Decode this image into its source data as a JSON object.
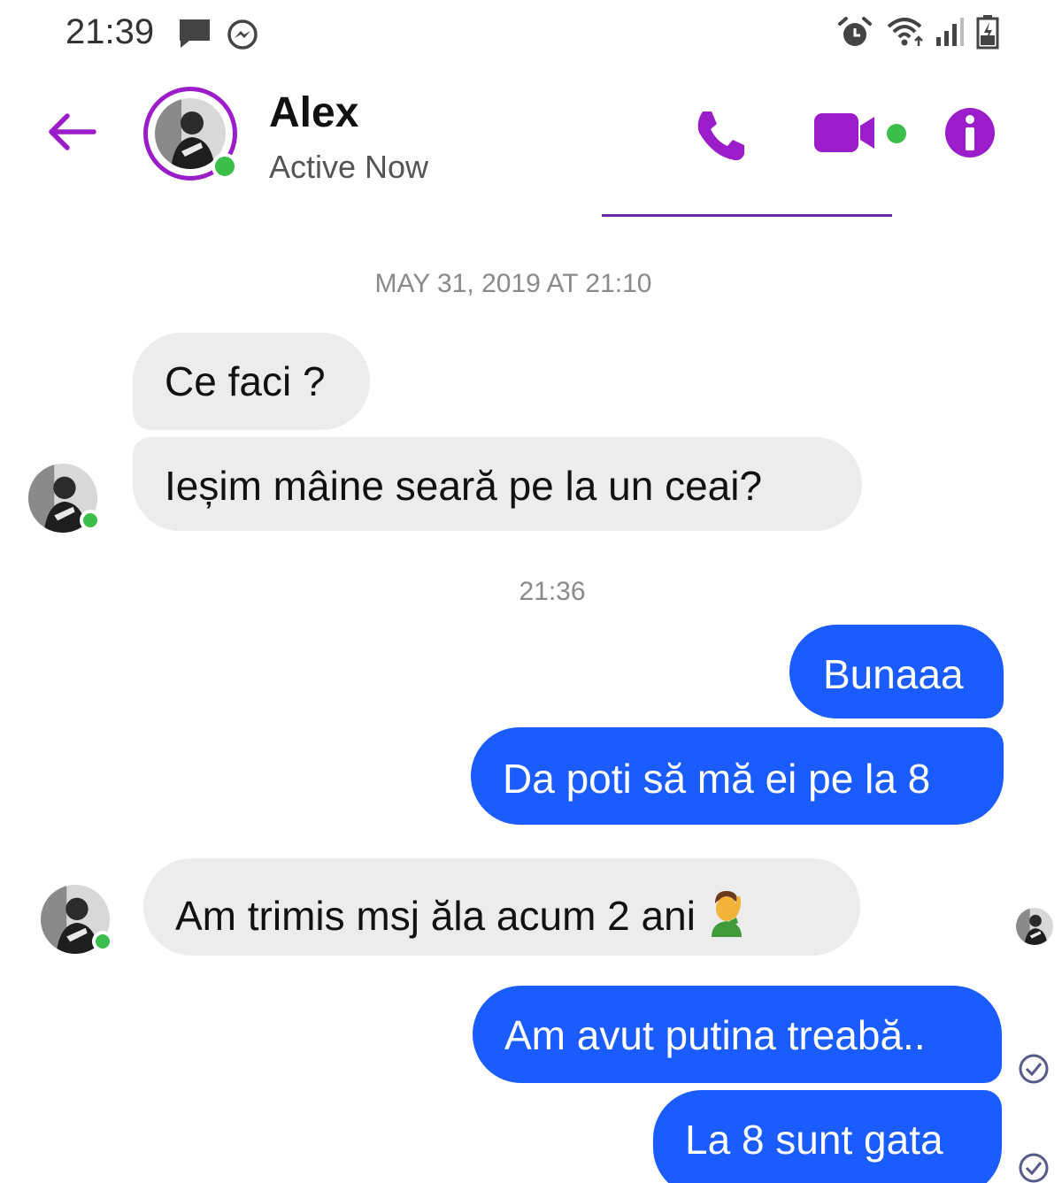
{
  "status_bar": {
    "time": "21:39",
    "icons": [
      "chat-icon",
      "messenger-icon",
      "alarm-icon",
      "wifi-icon",
      "signal-icon",
      "battery-icon"
    ]
  },
  "header": {
    "contact_name": "Alex",
    "contact_status": "Active Now",
    "icons": [
      "back-arrow-icon",
      "phone-icon",
      "video-camera-icon",
      "info-icon"
    ],
    "accent_color": "#9b1dc9",
    "online_color": "#3bbf4a"
  },
  "conversation": {
    "timestamps": [
      "MAY 31, 2019 AT 21:10",
      "21:36"
    ],
    "messages": [
      {
        "direction": "incoming",
        "text": "Ce faci ?"
      },
      {
        "direction": "incoming",
        "text": "Ieșim mâine seară pe la un ceai?"
      },
      {
        "direction": "outgoing",
        "text": "Bunaaa"
      },
      {
        "direction": "outgoing",
        "text": "Da poti să mă ei pe la 8"
      },
      {
        "direction": "incoming",
        "text": "Am trimis msj ăla acum 2 ani",
        "emoji": "man-facepalming-emoji"
      },
      {
        "direction": "outgoing",
        "text": "Am avut putina treabă.."
      },
      {
        "direction": "outgoing",
        "text": "La 8 sunt gata"
      }
    ],
    "incoming_bubble_color": "#ececec",
    "outgoing_bubble_color": "#1a5cff"
  }
}
